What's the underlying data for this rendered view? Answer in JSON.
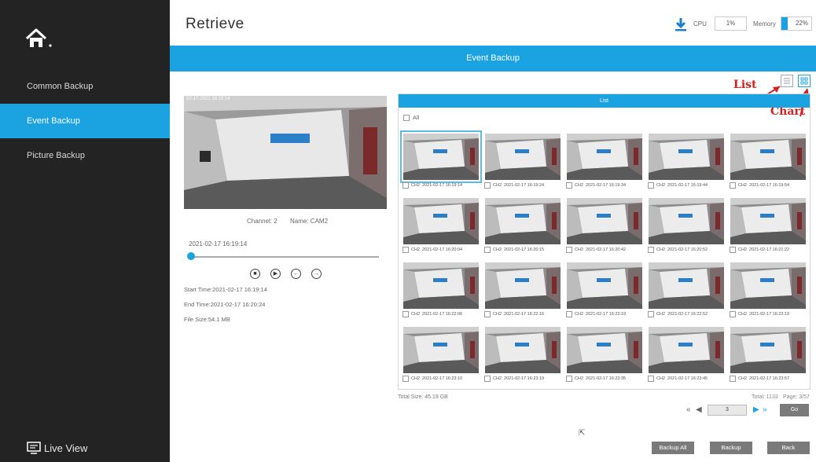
{
  "sidebar": {
    "items": [
      {
        "label": "Common Backup"
      },
      {
        "label": "Event Backup"
      },
      {
        "label": "Picture Backup"
      }
    ],
    "live_view": "Live View"
  },
  "header": {
    "title": "Retrieve",
    "cpu_label": "CPU",
    "cpu_value": "1%",
    "memory_label": "Memory",
    "memory_value": "22%",
    "memory_fraction": 0.22
  },
  "banner": "Event Backup",
  "annotations": {
    "list": "List",
    "chart": "Chart"
  },
  "preview": {
    "timestamp": "02-17-2021 16:19:14",
    "channel": "Channel: 2",
    "name": "Name: CAM2",
    "playback_time": "2021-02-17 16:19:14",
    "start_time": "Start Time:2021-02-17 16:19:14",
    "end_time": "End Time:2021-02-17 16:20:24",
    "file_size": "File Size:54.1 MB"
  },
  "grid": {
    "header": "List",
    "all_label": "All",
    "thumbnails": [
      {
        "channel": "CH2",
        "time": "2021-02-17 16:19:14",
        "selected": true
      },
      {
        "channel": "CH2",
        "time": "2021-02-17 16:19:24"
      },
      {
        "channel": "CH2",
        "time": "2021-02-17 16:19:34"
      },
      {
        "channel": "CH2",
        "time": "2021-02-17 16:19:44"
      },
      {
        "channel": "CH2",
        "time": "2021-02-17 16:19:54"
      },
      {
        "channel": "CH2",
        "time": "2021-02-17 16:20:04"
      },
      {
        "channel": "CH2",
        "time": "2021-02-17 16:20:15"
      },
      {
        "channel": "CH2",
        "time": "2021-02-17 16:20:42"
      },
      {
        "channel": "CH2",
        "time": "2021-02-17 16:20:52"
      },
      {
        "channel": "CH2",
        "time": "2021-02-17 16:21:22"
      },
      {
        "channel": "CH2",
        "time": "2021-02-17 16:22:06"
      },
      {
        "channel": "CH2",
        "time": "2021-02-17 16:22:16"
      },
      {
        "channel": "CH2",
        "time": "2021-02-17 16:23:19"
      },
      {
        "channel": "CH2",
        "time": "2021-02-17 16:22:52"
      },
      {
        "channel": "CH2",
        "time": "2021-02-17 16:23:19"
      },
      {
        "channel": "CH2",
        "time": "2021-02-17 16:23:10"
      },
      {
        "channel": "CH2",
        "time": "2021-02-17 16:23:19"
      },
      {
        "channel": "CH2",
        "time": "2021-02-17 16:23:35"
      },
      {
        "channel": "CH2",
        "time": "2021-02-17 16:23:45"
      },
      {
        "channel": "CH2",
        "time": "2021-02-17 16:23:57"
      }
    ]
  },
  "footer": {
    "total_size": "Total Size: 45.19 GB",
    "total": "Total: 1133",
    "page": "Page: 3/57",
    "page_input": "3",
    "go": "Go"
  },
  "buttons": {
    "backup_all": "Backup All",
    "backup": "Backup",
    "back": "Back"
  },
  "colors": {
    "accent": "#1aa3e0",
    "sidebar": "#232323",
    "button": "#7a7a7a",
    "annotation": "#d61f1f"
  }
}
